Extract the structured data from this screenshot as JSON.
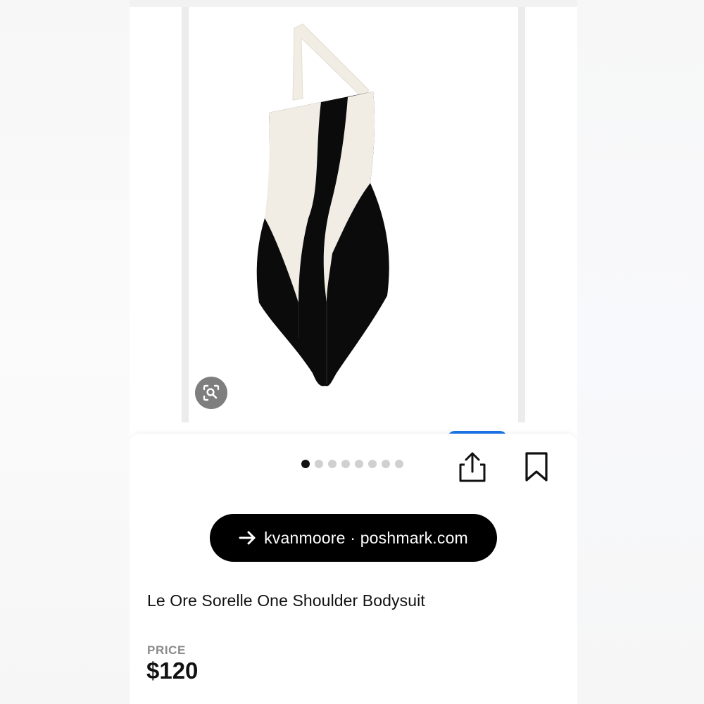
{
  "product": {
    "image_alt": "Le Ore Sorelle One Shoulder Bodysuit",
    "carousel": {
      "total": 8,
      "active_index": 0
    }
  },
  "actions": {
    "share_icon": "share-icon",
    "save_icon": "bookmark-icon",
    "lens_icon": "visual-search-icon"
  },
  "visit": {
    "icon": "arrow-right-icon",
    "label": "kvanmoore · poshmark.com"
  },
  "listing": {
    "title": "Le Ore Sorelle One Shoulder Bodysuit",
    "price_label": "PRICE",
    "price": "$120"
  },
  "colors": {
    "pill_bg": "#000000",
    "accent_blue": "#1a73e8",
    "cream": "#f1ede4",
    "garment_black": "#0b0b0b"
  }
}
